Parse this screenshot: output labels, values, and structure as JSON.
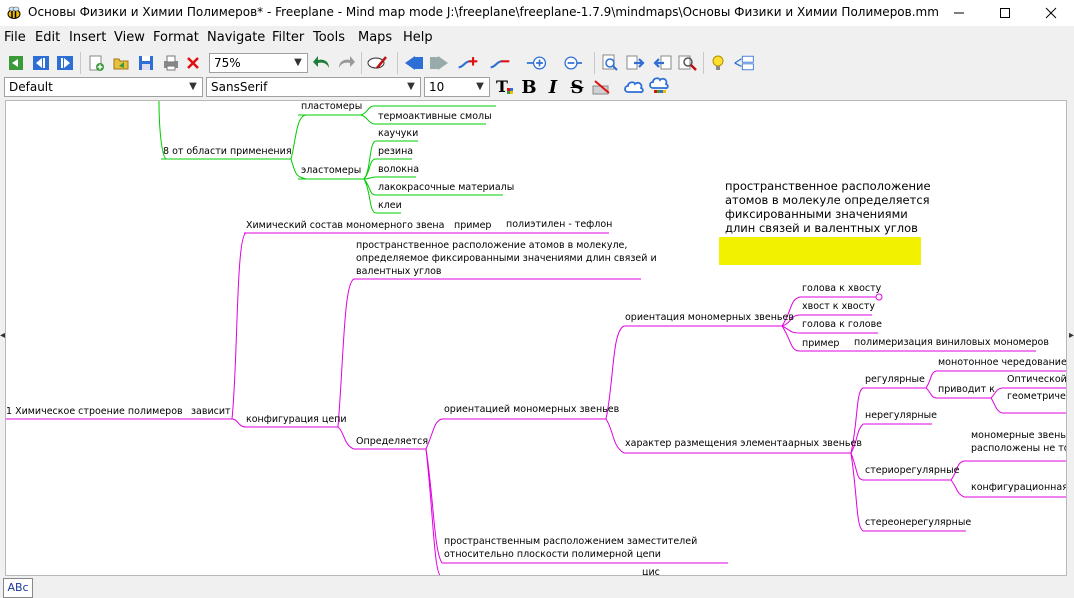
{
  "window": {
    "title": "Основы Физики и Химии Полимеров* - Freeplane - Mind map mode J:\\freeplane\\freeplane-1.7.9\\mindmaps\\Основы Физики и Химии Полимеров.mm",
    "minimize_icon": "minimize-icon",
    "maximize_icon": "maximize-icon",
    "close_icon": "close-icon"
  },
  "menu": [
    "File",
    "Edit",
    "Insert",
    "View",
    "Format",
    "Navigate",
    "Filter",
    "Tools",
    "Maps",
    "Help"
  ],
  "toolbar": {
    "zoom": "75%",
    "style": "Default",
    "font": "SansSerif",
    "font_size": "10",
    "bold_label": "B",
    "italic_label": "I",
    "strike_label": "S"
  },
  "status": {
    "spellcheck_label": "ABc"
  },
  "colors": {
    "green_branch": "#00cc00",
    "magenta_branch": "#e000e0",
    "highlight": "#f2f200"
  },
  "map": {
    "green": {
      "plastomers": "пластомеры",
      "thermoactive": "термоактивные смолы",
      "by_field": "8 от области применения",
      "elastomers": "эластомеры",
      "rubbers": "каучуки",
      "resin": "резина",
      "fibers": "волокна",
      "paints": "лакокрасочные материалы",
      "glues": "клеи"
    },
    "note": {
      "line1": "пространственное расположение",
      "line2": "атомов в молекуле определяется",
      "line3": "фиксированными значениями",
      "line4": "длин связей и валентных углов"
    },
    "magenta": {
      "root": "1 Химическое строение полимеров",
      "depends": "зависит",
      "chem_comp": "Химический  состав мономерного звена",
      "example": "пример",
      "pe_tf": "полиэтилен - тефлон",
      "spatial1": "пространственное расположение атомов в  молекуле,",
      "spatial2": "определяемое фиксированными значениями длин связей и",
      "spatial3": "валентных углов",
      "config": "конфигурация цепи",
      "determined": "Определяется",
      "orient_units": "ориентацией мономерных звеньев",
      "orientation": "ориентация мономерных звеньев",
      "head_tail": "голова к хвосту",
      "tail_head": "хвост к хвосту",
      "head_head": "голова к голове",
      "example2": "пример",
      "vinyl": "полимеризация виниловых мономеров",
      "character": "характер размещения элементаарных звеньев",
      "regular": "регулярные",
      "monotone": "монотонное чередование зв",
      "leads_to": "приводит к",
      "optical": "Оптической и",
      "geometric": "геометричес",
      "irregular": "нерегулярные",
      "stereoregular": "стериорегулярные",
      "mono_units1": "мономерные звенья н",
      "mono_units2": "расположены не толь",
      "config_o": "конфигурационная о",
      "stereoirregular": "стереонерегулярные",
      "subst1": "пространственным расположением заместителей",
      "subst2": "относительно плоскости полимерной цепи",
      "cis": "цис"
    }
  }
}
